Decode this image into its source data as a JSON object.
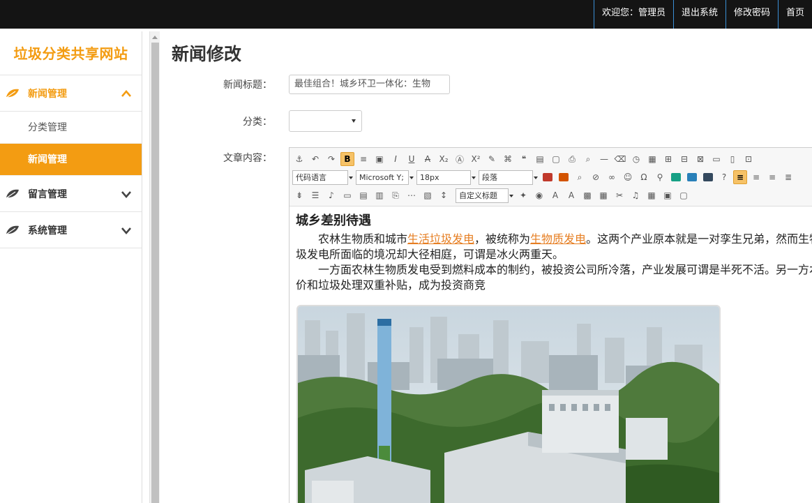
{
  "topnav": {
    "welcome": "欢迎您：管理员",
    "logout": "退出系统",
    "change_password": "修改密码",
    "home": "首页"
  },
  "sidebar": {
    "logo": "垃圾分类共享网站",
    "groups": [
      {
        "label": "新闻管理",
        "expanded": true,
        "icon": "leaf-icon"
      },
      {
        "label": "留言管理",
        "expanded": false,
        "icon": "leaf-icon"
      },
      {
        "label": "系统管理",
        "expanded": false,
        "icon": "leaf-icon"
      }
    ],
    "sub_items": [
      "分类管理",
      "新闻管理"
    ]
  },
  "main": {
    "title": "新闻修改",
    "form": {
      "title_label": "新闻标题：",
      "title_value": "最佳组合！城乡环卫一体化：生物",
      "category_label": "分类：",
      "category_value": "",
      "content_label": "文章内容："
    }
  },
  "editor": {
    "toolbar": {
      "code_language": "代码语言",
      "font_family": "Microsoft Y;",
      "font_size": "18px",
      "paragraph": "段落",
      "custom_title": "自定义标题"
    },
    "heading": "城乡差别待遇",
    "para1_prefix": "农林生物质和城市",
    "link1": "生活垃圾发电",
    "para1_mid": "，被统称为",
    "link2": "生物质发电",
    "para1_suffix": "。这两个产业原本就是一对孪生兄弟，然而生物质发电和城市生活垃圾发电所面临的境况却大径相庭，可谓是冰火两重天。",
    "para2": "一方面农林生物质发电受到燃料成本的制约，被投资公司所冷落，产业发展可谓是半死不活。另一方本制约，相反还享受电价和垃圾处理双重补贴，成为投资商竞"
  },
  "colors": {
    "accent": "#f39c12",
    "topbar": "#141414",
    "link": "#e67e22"
  }
}
